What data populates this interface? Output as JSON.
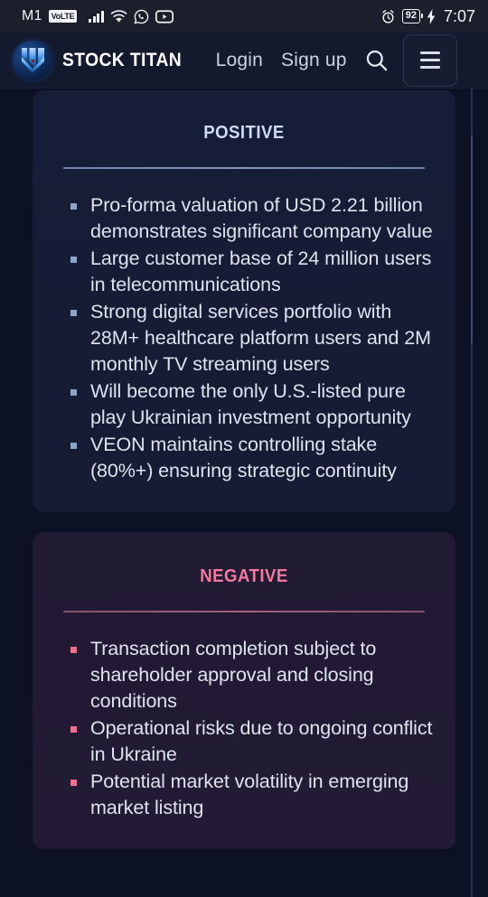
{
  "status_bar": {
    "carrier": "M1",
    "volte_badge": "VoLTE",
    "icons": [
      "signal-bars-icon",
      "wifi-icon",
      "whatsapp-icon",
      "youtube-icon",
      "alarm-icon",
      "charging-bolt-icon"
    ],
    "battery_percent": "92",
    "time": "7:07"
  },
  "header": {
    "brand_name": "STOCK TITAN",
    "login_label": "Login",
    "signup_label": "Sign up",
    "search_icon": "search-icon",
    "menu_icon": "hamburger-menu-icon"
  },
  "cards": {
    "positive": {
      "title": "Positive",
      "accent_color": "#cddcf3",
      "bullet_color": "#8ea4c6",
      "items": [
        "Pro-forma valuation of USD 2.21 billion demonstrates significant company value",
        "Large customer base of 24 million users in telecommunications",
        "Strong digital services portfolio with 28M+ healthcare platform users and 2M monthly TV streaming users",
        "Will become the only U.S.-listed pure play Ukrainian investment opportunity",
        "VEON maintains controlling stake (80%+) ensuring strategic continuity"
      ]
    },
    "negative": {
      "title": "Negative",
      "accent_color": "#f4799f",
      "bullet_color": "#e8738f",
      "items": [
        "Transaction completion subject to shareholder approval and closing conditions",
        "Operational risks due to ongoing conflict in Ukraine",
        "Potential market volatility in emerging market listing"
      ]
    }
  }
}
